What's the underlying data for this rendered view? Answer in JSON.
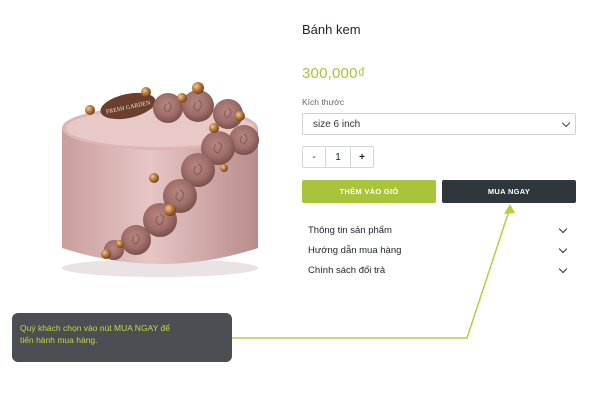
{
  "product": {
    "title": "Bánh kem",
    "price": "300,000₫",
    "plaque_text": "FRESH GARDEN",
    "size_label": "Kích thước",
    "size_selected": "size 6 inch",
    "quantity": "1",
    "minus_label": "-",
    "plus_label": "+"
  },
  "buttons": {
    "add_to_cart": "THÊM VÀO GIỎ",
    "buy_now": "MUA NGAY"
  },
  "accordion": [
    {
      "label": "Thông tin sản phẩm"
    },
    {
      "label": "Hướng dẫn mua hàng"
    },
    {
      "label": "Chính sách đổi trả"
    }
  ],
  "callout": {
    "line1": "Quý khách chọn vào nút MUA NGAY để",
    "line2": "tiến hành mua hàng."
  },
  "colors": {
    "accent_green": "#a9c43b",
    "dark_button": "#2f363c",
    "callout_bg": "#4b4f53",
    "callout_text": "#c8d742",
    "cake_pink": "#cba4a3"
  },
  "icons": {
    "select": "chevron-down-icon",
    "accordion": "chevron-down-icon"
  }
}
